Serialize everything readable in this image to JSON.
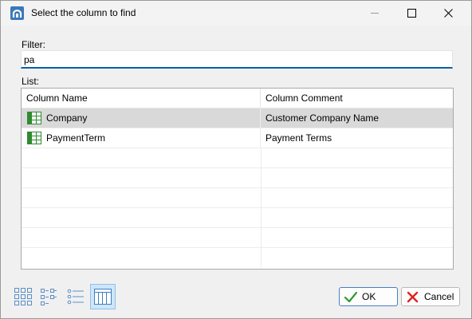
{
  "window": {
    "title": "Select the column to find"
  },
  "filter": {
    "label": "Filter:",
    "value": "pa"
  },
  "list": {
    "label": "List:",
    "columns": [
      "Column Name",
      "Column Comment"
    ],
    "rows": [
      {
        "name": "Company",
        "comment": "Customer Company Name",
        "selected": true,
        "icon": "table-column-icon"
      },
      {
        "name": "PaymentTerm",
        "comment": "Payment Terms",
        "selected": false,
        "icon": "table-column-icon"
      }
    ]
  },
  "toolbar": {
    "view_buttons": [
      "large-icons-view-icon",
      "small-icons-view-icon",
      "list-view-icon",
      "details-view-icon"
    ],
    "active_view": "details-view-icon"
  },
  "buttons": {
    "ok_label": "OK",
    "cancel_label": "Cancel"
  },
  "colors": {
    "accent": "#0b5fa8",
    "selected_row": "#d9d9d9",
    "icon_green": "#2e8b2e"
  }
}
